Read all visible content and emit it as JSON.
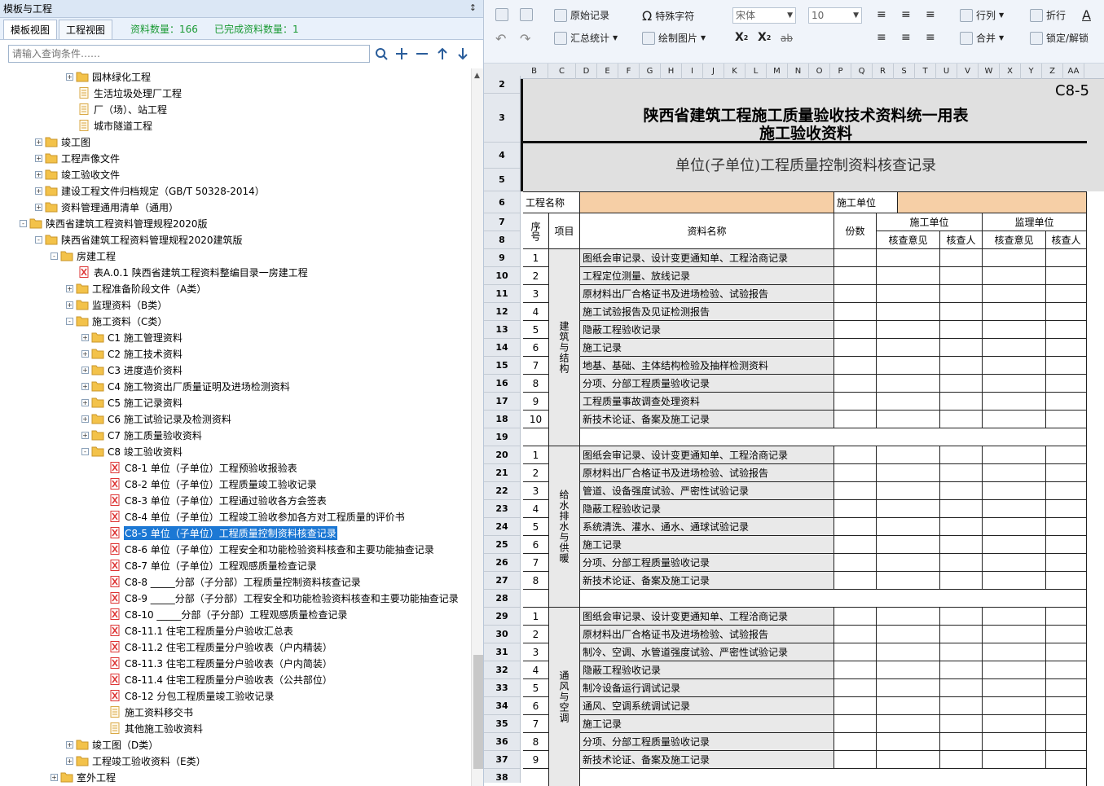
{
  "panel": {
    "title": "模板与工程",
    "pin": "↕"
  },
  "tabs": [
    {
      "label": "模板视图"
    },
    {
      "label": "工程视图"
    }
  ],
  "stats": {
    "count": "资料数量：166",
    "done": "已完成资料数量：1"
  },
  "search": {
    "placeholder": "请输入查询条件……"
  },
  "tree": [
    {
      "label": "园林绿化工程",
      "lvl": 3,
      "ico": "folder",
      "exp": "+"
    },
    {
      "label": "生活垃圾处理厂工程",
      "lvl": 3,
      "ico": "doc"
    },
    {
      "label": "厂（场）、站工程",
      "lvl": 3,
      "ico": "doc"
    },
    {
      "label": "城市隧道工程",
      "lvl": 3,
      "ico": "doc"
    },
    {
      "label": "竣工图",
      "lvl": 1,
      "ico": "folder",
      "exp": "+"
    },
    {
      "label": "工程声像文件",
      "lvl": 1,
      "ico": "folder",
      "exp": "+"
    },
    {
      "label": "竣工验收文件",
      "lvl": 1,
      "ico": "folder",
      "exp": "+"
    },
    {
      "label": "建设工程文件归档规定（GB/T 50328-2014）",
      "lvl": 1,
      "ico": "folder",
      "exp": "+"
    },
    {
      "label": "资料管理通用清单（通用）",
      "lvl": 1,
      "ico": "folder",
      "exp": "+"
    },
    {
      "label": "陕西省建筑工程资料管理规程2020版",
      "lvl": 0,
      "ico": "folder",
      "exp": "-"
    },
    {
      "label": "陕西省建筑工程资料管理规程2020建筑版",
      "lvl": 1,
      "ico": "folder",
      "exp": "-"
    },
    {
      "label": "房建工程",
      "lvl": 2,
      "ico": "folder",
      "exp": "-"
    },
    {
      "label": "表A.0.1 陕西省建筑工程资料整编目录一房建工程",
      "lvl": 3,
      "ico": "pdf"
    },
    {
      "label": "工程准备阶段文件（A类）",
      "lvl": 3,
      "ico": "folder",
      "exp": "+"
    },
    {
      "label": "监理资料（B类）",
      "lvl": 3,
      "ico": "folder",
      "exp": "+"
    },
    {
      "label": "施工资料（C类）",
      "lvl": 3,
      "ico": "folder",
      "exp": "-"
    },
    {
      "label": "C1 施工管理资料",
      "lvl": 4,
      "ico": "folder",
      "exp": "+"
    },
    {
      "label": "C2 施工技术资料",
      "lvl": 4,
      "ico": "folder",
      "exp": "+"
    },
    {
      "label": "C3 进度造价资料",
      "lvl": 4,
      "ico": "folder",
      "exp": "+"
    },
    {
      "label": "C4 施工物资出厂质量证明及进场检测资料",
      "lvl": 4,
      "ico": "folder",
      "exp": "+"
    },
    {
      "label": "C5 施工记录资料",
      "lvl": 4,
      "ico": "folder",
      "exp": "+"
    },
    {
      "label": "C6 施工试验记录及检测资料",
      "lvl": 4,
      "ico": "folder",
      "exp": "+"
    },
    {
      "label": "C7 施工质量验收资料",
      "lvl": 4,
      "ico": "folder",
      "exp": "+"
    },
    {
      "label": "C8 竣工验收资料",
      "lvl": 4,
      "ico": "folder",
      "exp": "-"
    },
    {
      "label": "C8-1 单位（子单位）工程预验收报验表",
      "lvl": 5,
      "ico": "pdf"
    },
    {
      "label": "C8-2 单位（子单位）工程质量竣工验收记录",
      "lvl": 5,
      "ico": "pdf"
    },
    {
      "label": "C8-3 单位（子单位）工程通过验收各方会签表",
      "lvl": 5,
      "ico": "pdf"
    },
    {
      "label": "C8-4 单位（子单位）工程竣工验收参加各方对工程质量的评价书",
      "lvl": 5,
      "ico": "pdf"
    },
    {
      "label": "C8-5 单位（子单位）工程质量控制资料核查记录",
      "lvl": 5,
      "ico": "pdf",
      "sel": true
    },
    {
      "label": "C8-6 单位（子单位）工程安全和功能检验资料核查和主要功能抽查记录",
      "lvl": 5,
      "ico": "pdf"
    },
    {
      "label": "C8-7 单位（子单位）工程观感质量检查记录",
      "lvl": 5,
      "ico": "pdf"
    },
    {
      "label": "C8-8 _____分部（子分部）工程质量控制资料核查记录",
      "lvl": 5,
      "ico": "pdf"
    },
    {
      "label": "C8-9 _____分部（子分部）工程安全和功能检验资料核查和主要功能抽查记录",
      "lvl": 5,
      "ico": "pdf"
    },
    {
      "label": "C8-10 _____分部（子分部）工程观感质量检查记录",
      "lvl": 5,
      "ico": "pdf"
    },
    {
      "label": "C8-11.1 住宅工程质量分户验收汇总表",
      "lvl": 5,
      "ico": "pdf"
    },
    {
      "label": "C8-11.2 住宅工程质量分户验收表（户内精装）",
      "lvl": 5,
      "ico": "pdf"
    },
    {
      "label": "C8-11.3 住宅工程质量分户验收表（户内简装）",
      "lvl": 5,
      "ico": "pdf"
    },
    {
      "label": "C8-11.4 住宅工程质量分户验收表（公共部位）",
      "lvl": 5,
      "ico": "pdf"
    },
    {
      "label": "C8-12 分包工程质量竣工验收记录",
      "lvl": 5,
      "ico": "pdf"
    },
    {
      "label": "施工资料移交书",
      "lvl": 5,
      "ico": "doc"
    },
    {
      "label": "其他施工验收资料",
      "lvl": 5,
      "ico": "doc"
    },
    {
      "label": "竣工图（D类）",
      "lvl": 3,
      "ico": "folder",
      "exp": "+"
    },
    {
      "label": "工程竣工验收资料（E类）",
      "lvl": 3,
      "ico": "folder",
      "exp": "+"
    },
    {
      "label": "室外工程",
      "lvl": 2,
      "ico": "folder",
      "exp": "+"
    }
  ],
  "toolbar": {
    "original": "原始记录",
    "special": "特殊字符",
    "summary": "汇总统计",
    "draw": "绘制图片",
    "font": "宋体",
    "size": "10",
    "rowcol": "行列",
    "merge": "合并",
    "wrap": "折行",
    "lock": "锁定/解锁",
    "sup": "X",
    "sup2": "2",
    "sub": "X",
    "sub2": "2",
    "strike": "ab"
  },
  "columns": [
    "B",
    "C",
    "D",
    "E",
    "F",
    "G",
    "H",
    "I",
    "J",
    "K",
    "L",
    "M",
    "N",
    "O",
    "P",
    "Q",
    "R",
    "S",
    "T",
    "U",
    "V",
    "W",
    "X",
    "Y",
    "Z",
    "AA"
  ],
  "rows": [
    "2",
    "3",
    "4",
    "5",
    "6",
    "7",
    "8",
    "9",
    "10",
    "11",
    "12",
    "13",
    "14",
    "15",
    "16",
    "17",
    "18",
    "19",
    "20",
    "21",
    "22",
    "23",
    "24",
    "25",
    "26",
    "27",
    "28",
    "29",
    "30",
    "31",
    "32",
    "33",
    "34",
    "35",
    "36",
    "37",
    "38"
  ],
  "form": {
    "code": "C8-5",
    "title1": "陕西省建筑工程施工质量验收技术资料统一用表",
    "title2": "施工验收资料",
    "subtitle": "单位(子单位)工程质量控制资料核查记录",
    "proj_name": "工程名称",
    "construct_unit": "施工单位",
    "h_seq": "序号",
    "h_item": "项目",
    "h_name": "资料名称",
    "h_copies": "份数",
    "h_cu": "施工单位",
    "h_su": "监理单位",
    "h_opinion": "核查意见",
    "h_checker": "核查人",
    "h_opinion2": "核查意见",
    "h_checker2": "核查人",
    "groups": [
      {
        "name": "建筑与结构",
        "items": [
          "图纸会审记录、设计变更通知单、工程洽商记录",
          "工程定位测量、放线记录",
          "原材料出厂合格证书及进场检验、试验报告",
          "施工试验报告及见证检测报告",
          "隐蔽工程验收记录",
          "施工记录",
          "地基、基础、主体结构检验及抽样检测资料",
          "分项、分部工程质量验收记录",
          "工程质量事故调查处理资料",
          "新技术论证、备案及施工记录"
        ]
      },
      {
        "name": "给水排水与供暖",
        "items": [
          "图纸会审记录、设计变更通知单、工程洽商记录",
          "原材料出厂合格证书及进场检验、试验报告",
          "管道、设备强度试验、严密性试验记录",
          "隐蔽工程验收记录",
          "系统清洗、灌水、通水、通球试验记录",
          "施工记录",
          "分项、分部工程质量验收记录",
          "新技术论证、备案及施工记录"
        ]
      },
      {
        "name": "通风与空调",
        "items": [
          "图纸会审记录、设计变更通知单、工程洽商记录",
          "原材料出厂合格证书及进场检验、试验报告",
          "制冷、空调、水管道强度试验、严密性试验记录",
          "隐蔽工程验收记录",
          "制冷设备运行调试记录",
          "通风、空调系统调试记录",
          "施工记录",
          "分项、分部工程质量验收记录",
          "新技术论证、备案及施工记录"
        ]
      }
    ]
  },
  "colors": {
    "selected": "#1c78d4",
    "tan": "#f6cfa6",
    "stat": "#1a9a34"
  }
}
